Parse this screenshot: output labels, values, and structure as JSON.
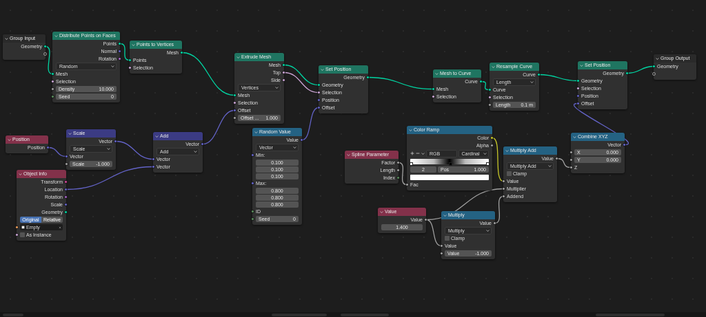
{
  "nodes": [
    {
      "title": "Group Input",
      "kind": "group",
      "rows": [
        {
          "kind": "output",
          "label": "Geometry",
          "color": "#00d6a3"
        },
        {
          "kind": "virtual-output"
        }
      ]
    },
    {
      "title": "Distribute Points on Faces",
      "kind": "geometry",
      "rows": [
        {
          "kind": "output",
          "label": "Points",
          "color": "#00d6a3"
        },
        {
          "kind": "output",
          "label": "Normal",
          "color": "#6363c7"
        },
        {
          "kind": "output",
          "label": "Rotation",
          "color": "#a663c7"
        },
        {
          "kind": "dropdown",
          "value": "Random"
        },
        {
          "kind": "input",
          "label": "Mesh",
          "color": "#00d6a3"
        },
        {
          "kind": "input",
          "label": "Selection",
          "color": "#cca6d6"
        },
        {
          "kind": "field",
          "label": "Density",
          "value": "10.000",
          "color": "#a1a1a1"
        },
        {
          "kind": "field",
          "label": "Seed",
          "value": "0",
          "color": "#598c5c"
        }
      ]
    },
    {
      "title": "Points to Vertices",
      "kind": "geometry",
      "rows": [
        {
          "kind": "output",
          "label": "Mesh",
          "color": "#00d6a3"
        },
        {
          "kind": "input",
          "label": "Points",
          "color": "#00d6a3"
        },
        {
          "kind": "input",
          "label": "Selection",
          "color": "#cca6d6"
        }
      ]
    },
    {
      "title": "Extrude Mesh",
      "kind": "geometry",
      "rows": [
        {
          "kind": "output",
          "label": "Mesh",
          "color": "#00d6a3"
        },
        {
          "kind": "output",
          "label": "Top",
          "color": "#cca6d6"
        },
        {
          "kind": "output",
          "label": "Side",
          "color": "#cca6d6"
        },
        {
          "kind": "dropdown",
          "value": "Vertices"
        },
        {
          "kind": "input",
          "label": "Mesh",
          "color": "#00d6a3"
        },
        {
          "kind": "input",
          "label": "Selection",
          "color": "#cca6d6"
        },
        {
          "kind": "input",
          "label": "Offset",
          "color": "#6363c7"
        },
        {
          "kind": "field",
          "label": "Offset ...",
          "value": "1.000",
          "color": "#a1a1a1"
        }
      ]
    },
    {
      "title": "Set Position",
      "kind": "geometry",
      "rows": [
        {
          "kind": "output",
          "label": "Geometry",
          "color": "#00d6a3"
        },
        {
          "kind": "input",
          "label": "Geometry",
          "color": "#00d6a3"
        },
        {
          "kind": "input",
          "label": "Selection",
          "color": "#cca6d6"
        },
        {
          "kind": "input",
          "label": "Position",
          "color": "#6363c7"
        },
        {
          "kind": "input",
          "label": "Offset",
          "color": "#6363c7"
        }
      ]
    },
    {
      "title": "Mesh to Curve",
      "kind": "geometry",
      "rows": [
        {
          "kind": "output",
          "label": "Curve",
          "color": "#00d6a3"
        },
        {
          "kind": "input",
          "label": "Mesh",
          "color": "#00d6a3"
        },
        {
          "kind": "input",
          "label": "Selection",
          "color": "#cca6d6"
        }
      ]
    },
    {
      "title": "Resample Curve",
      "kind": "geometry",
      "rows": [
        {
          "kind": "output",
          "label": "Curve",
          "color": "#00d6a3"
        },
        {
          "kind": "dropdown",
          "value": "Length"
        },
        {
          "kind": "input",
          "label": "Curve",
          "color": "#00d6a3"
        },
        {
          "kind": "input",
          "label": "Selection",
          "color": "#cca6d6"
        },
        {
          "kind": "field",
          "label": "Length",
          "value": "0.1 m",
          "color": "#a1a1a1"
        }
      ]
    },
    {
      "title": "Set Position",
      "kind": "geometry",
      "rows": [
        {
          "kind": "output",
          "label": "Geometry",
          "color": "#00d6a3"
        },
        {
          "kind": "input",
          "label": "Geometry",
          "color": "#00d6a3"
        },
        {
          "kind": "input",
          "label": "Selection",
          "color": "#cca6d6"
        },
        {
          "kind": "input",
          "label": "Position",
          "color": "#6363c7"
        },
        {
          "kind": "input",
          "label": "Offset",
          "color": "#6363c7"
        }
      ]
    },
    {
      "title": "Group Output",
      "kind": "group",
      "rows": [
        {
          "kind": "input",
          "label": "Geometry",
          "color": "#00d6a3"
        },
        {
          "kind": "virtual-input"
        }
      ]
    },
    {
      "title": "Position",
      "kind": "input",
      "rows": [
        {
          "kind": "output",
          "label": "Position",
          "color": "#6363c7"
        }
      ]
    },
    {
      "title": "Scale",
      "kind": "vector",
      "rows": [
        {
          "kind": "output",
          "label": "Vector",
          "color": "#6363c7"
        },
        {
          "kind": "dropdown",
          "value": "Scale"
        },
        {
          "kind": "input",
          "label": "Vector",
          "color": "#6363c7"
        },
        {
          "kind": "field",
          "label": "Scale",
          "value": "-1.000",
          "color": "#a1a1a1"
        }
      ]
    },
    {
      "title": "Add",
      "kind": "vector",
      "rows": [
        {
          "kind": "output",
          "label": "Vector",
          "color": "#6363c7"
        },
        {
          "kind": "dropdown",
          "value": "Add"
        },
        {
          "kind": "input",
          "label": "Vector",
          "color": "#6363c7"
        },
        {
          "kind": "input",
          "label": "Vector",
          "color": "#6363c7"
        }
      ]
    },
    {
      "title": "Object Info",
      "kind": "input",
      "rows": [
        {
          "kind": "output",
          "label": "Transform",
          "color": "#d8489c"
        },
        {
          "kind": "output",
          "label": "Location",
          "color": "#6363c7"
        },
        {
          "kind": "output",
          "label": "Rotation",
          "color": "#a663c7"
        },
        {
          "kind": "output",
          "label": "Scale",
          "color": "#6363c7"
        },
        {
          "kind": "output",
          "label": "Geometry",
          "color": "#00d6a3"
        },
        {
          "kind": "toggle",
          "options": [
            {
              "label": "Original",
              "selected": true
            },
            {
              "label": "Relative",
              "selected": false
            }
          ]
        },
        {
          "kind": "object",
          "value": "Empty",
          "color": "#ed9e5c"
        },
        {
          "kind": "checkbox",
          "label": "As Instance",
          "checked": false,
          "color": "#cca6d6"
        }
      ]
    },
    {
      "title": "Random Value",
      "kind": "converter",
      "rows": [
        {
          "kind": "output",
          "label": "Value",
          "color": "#6363c7"
        },
        {
          "kind": "dropdown",
          "value": "Vector"
        },
        {
          "kind": "input",
          "label": "Min:",
          "color": "#6363c7"
        },
        {
          "kind": "vector",
          "value": "0.100"
        },
        {
          "kind": "vector",
          "value": "0.100"
        },
        {
          "kind": "vector",
          "value": "0.100"
        },
        {
          "kind": "input",
          "label": "Max:",
          "color": "#6363c7"
        },
        {
          "kind": "vector",
          "value": "0.800"
        },
        {
          "kind": "vector",
          "value": "0.800"
        },
        {
          "kind": "vector",
          "value": "0.800"
        },
        {
          "kind": "input",
          "label": "ID",
          "color": "#598c5c"
        },
        {
          "kind": "field",
          "label": "Seed",
          "value": "0",
          "color": "#598c5c"
        }
      ]
    },
    {
      "title": "Color Ramp",
      "kind": "converter",
      "rows": [
        {
          "kind": "output",
          "label": "Color",
          "color": "#c7c729"
        },
        {
          "kind": "output",
          "label": "Alpha",
          "color": "#a1a1a1"
        },
        {
          "kind": "ramp-controls",
          "color_mode": "RGB",
          "interpolation": "Cardinal"
        },
        {
          "kind": "gradient"
        },
        {
          "kind": "stop",
          "index": "2",
          "label": "Pos",
          "value": "1.000"
        },
        {
          "kind": "swatch",
          "color": "#ffffff"
        },
        {
          "kind": "input",
          "label": "Fac",
          "color": "#a1a1a1"
        }
      ]
    },
    {
      "title": "Spline Parameter",
      "kind": "input",
      "rows": [
        {
          "kind": "output",
          "label": "Factor",
          "color": "#a1a1a1"
        },
        {
          "kind": "output",
          "label": "Length",
          "color": "#a1a1a1"
        },
        {
          "kind": "output",
          "label": "Index",
          "color": "#598c5c"
        }
      ]
    },
    {
      "title": "Multiply Add",
      "kind": "converter",
      "rows": [
        {
          "kind": "output",
          "label": "Value",
          "color": "#a1a1a1"
        },
        {
          "kind": "dropdown",
          "value": "Multiply Add"
        },
        {
          "kind": "checkbox",
          "label": "Clamp",
          "checked": false
        },
        {
          "kind": "input",
          "label": "Value",
          "color": "#a1a1a1"
        },
        {
          "kind": "input",
          "label": "Multiplier",
          "color": "#a1a1a1"
        },
        {
          "kind": "input",
          "label": "Addend",
          "color": "#a1a1a1"
        }
      ]
    },
    {
      "title": "Combine XYZ",
      "kind": "converter",
      "rows": [
        {
          "kind": "output",
          "label": "Vector",
          "color": "#6363c7"
        },
        {
          "kind": "field",
          "label": "X",
          "value": "0.000",
          "color": "#a1a1a1"
        },
        {
          "kind": "field",
          "label": "Y",
          "value": "0.000",
          "color": "#a1a1a1"
        },
        {
          "kind": "input",
          "label": "Z",
          "color": "#a1a1a1"
        }
      ]
    },
    {
      "title": "Value",
      "kind": "input",
      "rows": [
        {
          "kind": "output",
          "label": "Value",
          "color": "#a1a1a1"
        },
        {
          "kind": "field",
          "value": "1.400"
        }
      ]
    },
    {
      "title": "Multiply",
      "kind": "converter",
      "rows": [
        {
          "kind": "output",
          "label": "Value",
          "color": "#a1a1a1"
        },
        {
          "kind": "dropdown",
          "value": "Multiply"
        },
        {
          "kind": "checkbox",
          "label": "Clamp",
          "checked": false
        },
        {
          "kind": "input",
          "label": "Value",
          "color": "#a1a1a1"
        },
        {
          "kind": "field",
          "label": "Value",
          "value": "-1.000",
          "color": "#a1a1a1"
        }
      ]
    }
  ]
}
